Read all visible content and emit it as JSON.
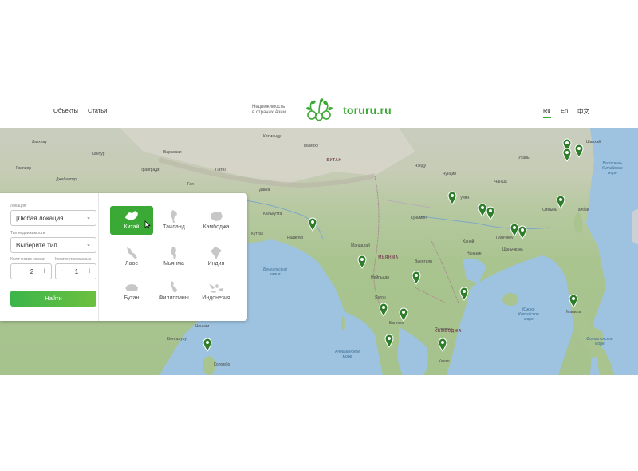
{
  "header": {
    "nav": [
      "Объекты",
      "Статьи"
    ],
    "tagline_line1": "Недвижимость",
    "tagline_line2": "в странах Азии",
    "logo_text": "toruru.ru",
    "languages": [
      {
        "label": "Ru",
        "active": true
      },
      {
        "label": "En",
        "active": false
      },
      {
        "label": "中文",
        "active": false
      }
    ]
  },
  "search": {
    "location_label": "Локация",
    "location_value": "|Любая локация",
    "type_label": "Тип недвижимости",
    "type_value": "Выберите тип",
    "rooms_label": "Количество комнат",
    "rooms_value": "2",
    "bathrooms_label": "Количество ванных",
    "bathrooms_value": "1",
    "submit_label": "Найти"
  },
  "countries": [
    {
      "name": "Китай",
      "active": true
    },
    {
      "name": "Таиланд",
      "active": false
    },
    {
      "name": "Камбоджа",
      "active": false
    },
    {
      "name": "Лаос",
      "active": false
    },
    {
      "name": "Мьянма",
      "active": false
    },
    {
      "name": "Индия",
      "active": false
    },
    {
      "name": "Бутан",
      "active": false
    },
    {
      "name": "Филиппины",
      "active": false
    },
    {
      "name": "Индонезия",
      "active": false
    }
  ],
  "map": {
    "labels": {
      "l1": "Лакхнау",
      "l2": "Канпур",
      "l3": "Гвалиор",
      "l4": "Праяградж",
      "l5": "Варанаси",
      "l6": "Джабалпур",
      "l7": "Гая",
      "l8": "Патна",
      "l9": "Катманду",
      "l10": "Тхимпху",
      "l11": "Дакка",
      "l12": "Калькутта",
      "l13": "Куттак",
      "l14": "Раджпур",
      "l15": "Мандалай",
      "l16": "Нейпьидо",
      "l17": "Янгон",
      "l18": "Вьентьян",
      "l19": "Бангкок",
      "l20": "Пномпень",
      "l21": "Ханой",
      "l22": "Куньмин",
      "l23": "Гуйян",
      "l24": "Чунцин",
      "l25": "Чэнду",
      "l26": "Ухань",
      "l27": "Чанша",
      "l28": "Гуанчжоу",
      "l29": "Шэньчжэнь",
      "l30": "Наньнин",
      "l31": "Тайбэй",
      "l32": "Манила",
      "l33": "Ченнаи",
      "l34": "Бенгалуру",
      "l35": "Коломбо",
      "l36": "Канто",
      "l37": "Сямынь",
      "l38": "Шанхай",
      "sea1": "Бенгальский\nзалив",
      "sea2": "Андаманское\nморе",
      "sea3": "Южно-\nКитайское\nморе",
      "sea4": "Восточно-\nКитайское\nморе",
      "sea5": "Филиппинское\nморе",
      "country1": "МЬЯНМА",
      "country2": "КАМБОДЖА",
      "country3": "БУТАН"
    }
  },
  "colors": {
    "accent": "#3aa935",
    "pin": "#2f7d2a",
    "water": "#9dc3e0"
  }
}
